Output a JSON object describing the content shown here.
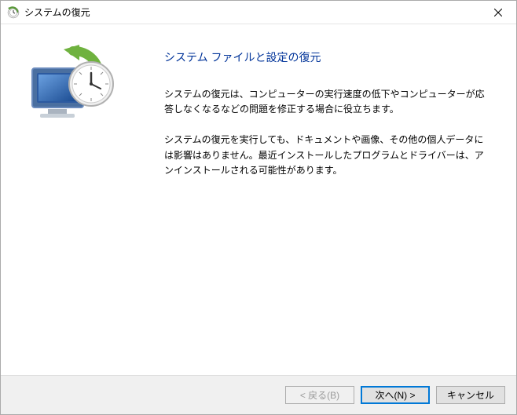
{
  "titlebar": {
    "title": "システムの復元"
  },
  "content": {
    "heading": "システム ファイルと設定の復元",
    "paragraph1": "システムの復元は、コンピューターの実行速度の低下やコンピューターが応答しなくなるなどの問題を修正する場合に役立ちます。",
    "paragraph2": "システムの復元を実行しても、ドキュメントや画像、その他の個人データには影響はありません。最近インストールしたプログラムとドライバーは、アンインストールされる可能性があります。"
  },
  "footer": {
    "back_label": "< 戻る(B)",
    "next_label": "次へ(N) >",
    "cancel_label": "キャンセル"
  }
}
